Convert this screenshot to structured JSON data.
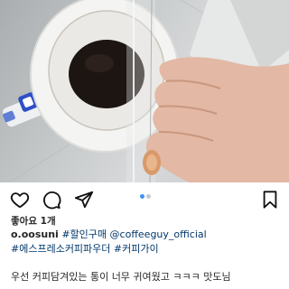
{
  "post": {
    "likes_text": "좋아요 1개",
    "username": "o.oosuni",
    "caption_line1_tag": "#할인구매",
    "caption_line1_mention": "@coffeeguy_official",
    "caption_line2_tag1": "#에스프레소커피파우더",
    "caption_line2_tag2": "#커피가이",
    "caption_line3": "우선 커피담겨있는 통이 너무 귀여웠고 ㅋㅋㅋ 맛도님"
  },
  "actions": {
    "like_icon": "heart-icon",
    "comment_icon": "comment-icon",
    "share_icon": "send-icon",
    "save_icon": "bookmark-icon"
  },
  "carousel": {
    "current_index": 1,
    "total": 2,
    "active_color": "#3897f0"
  }
}
